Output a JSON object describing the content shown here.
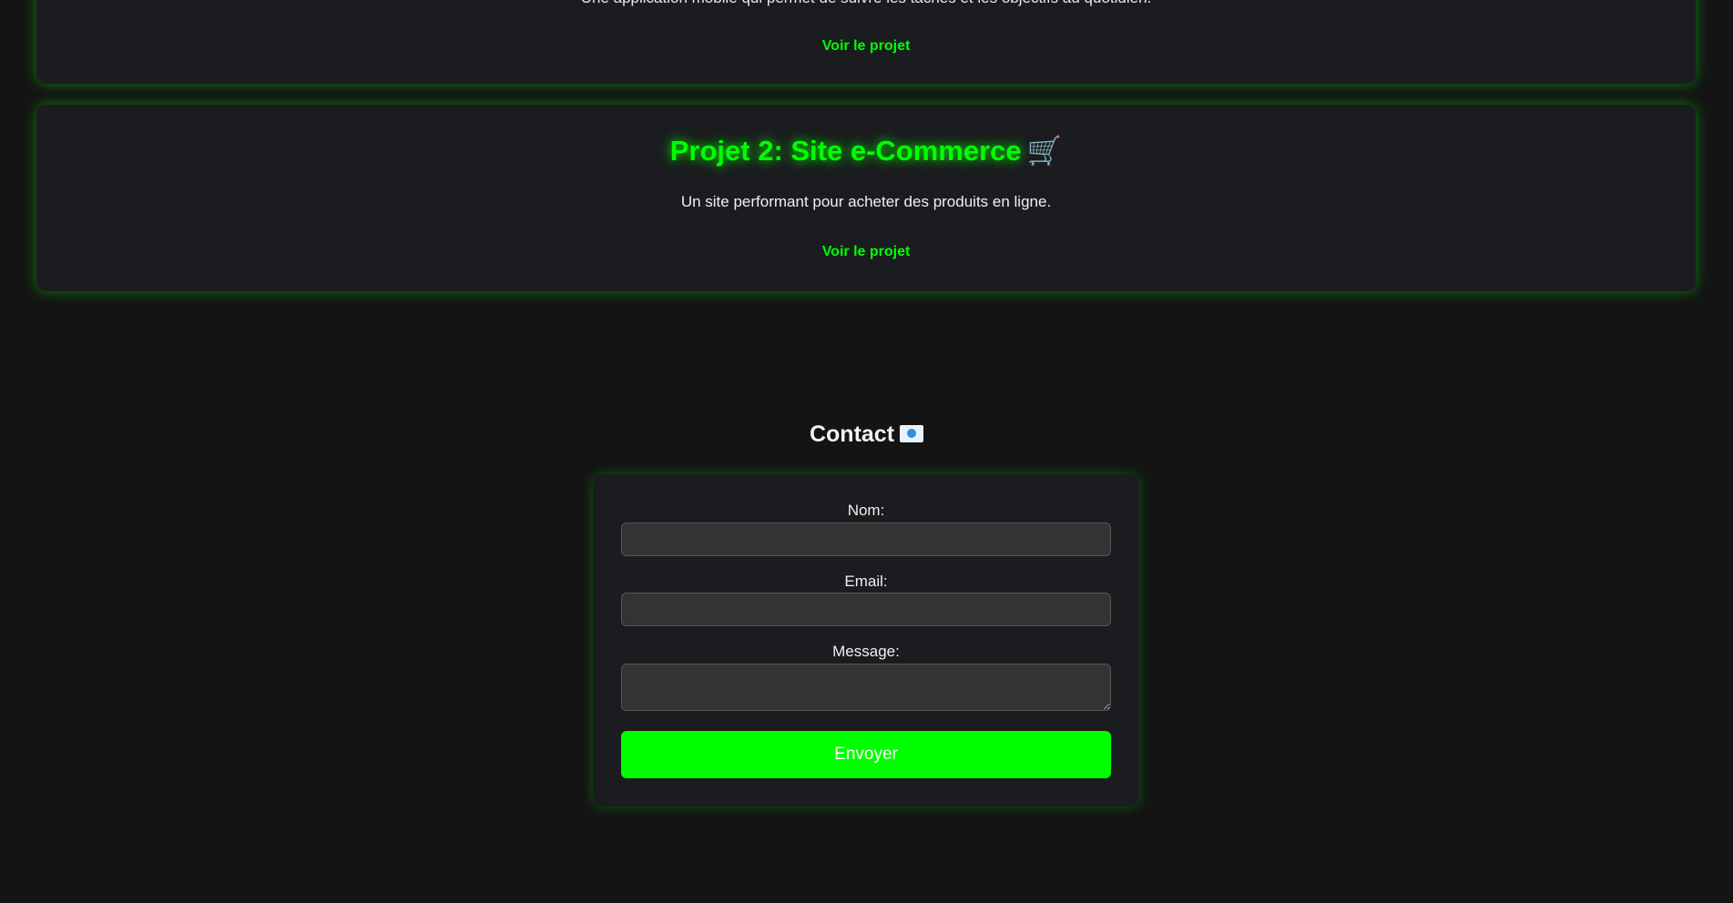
{
  "projects": [
    {
      "description": "Une application mobile qui permet de suivre les tâches et les objectifs au quotidien.",
      "link_label": "Voir le projet"
    },
    {
      "title": "Projet 2: Site e-Commerce",
      "title_emoji": "🛒",
      "description": "Un site performant pour acheter des produits en ligne.",
      "link_label": "Voir le projet"
    }
  ],
  "contact": {
    "title": "Contact",
    "title_icon": "envelope-icon",
    "fields": {
      "nom_label": "Nom:",
      "nom_value": "",
      "email_label": "Email:",
      "email_value": "",
      "message_label": "Message:",
      "message_value": ""
    },
    "submit_label": "Envoyer"
  },
  "colors": {
    "background": "#141414",
    "card_background": "#1b1c1f",
    "accent": "#00ff00",
    "input_background": "#333333"
  }
}
